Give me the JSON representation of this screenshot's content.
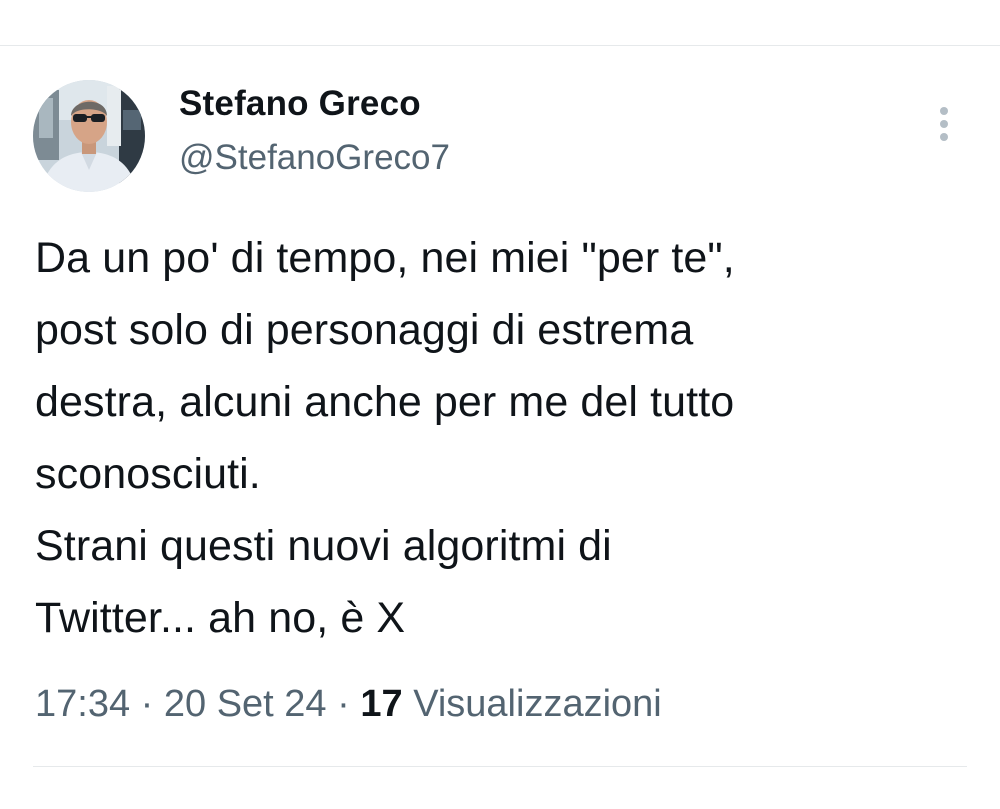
{
  "author": {
    "display_name": "Stefano Greco",
    "handle": "@StefanoGreco7"
  },
  "tweet": {
    "text": "Da un po' di tempo, nei miei \"per te\",\npost solo di personaggi di estrema\ndestra, alcuni anche per me del tutto\nsconosciuti.\nStrani questi nuovi algoritmi di\nTwitter... ah no, è X"
  },
  "meta": {
    "time": "17:34",
    "separator": " · ",
    "date": "20 Set 24",
    "views_count": "17",
    "views_label": "Visualizzazioni"
  },
  "icons": {
    "more": "vertical-ellipsis-icon"
  },
  "colors": {
    "text_primary": "#0f1419",
    "text_secondary": "#536471",
    "divider": "#e6e9eb",
    "icon_muted": "#b4bec6"
  }
}
